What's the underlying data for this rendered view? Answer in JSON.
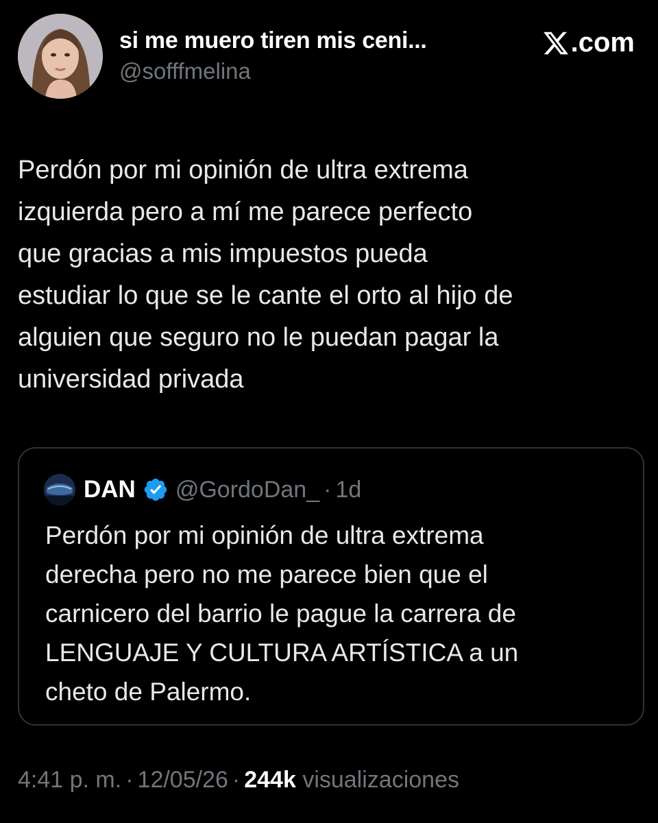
{
  "author": {
    "display_name": "si me muero tiren mis ceni...",
    "handle": "@sofffmelina"
  },
  "brand": {
    "domain_suffix": ".com",
    "icon": "x-logo-icon",
    "color": "#ffffff"
  },
  "tweet": {
    "lines": [
      "Perdón por mi opinión de ultra extrema",
      "izquierda pero a mí me parece perfecto",
      "que gracias a mis impuestos pueda",
      "estudiar lo que se le cante el orto al hijo de",
      "alguien que seguro no le puedan pagar la",
      "universidad privada"
    ]
  },
  "quoted_tweet": {
    "display_name": "DAN",
    "verified_icon": "verified-badge-icon",
    "verified_color": "#1d9bf0",
    "handle": "@GordoDan_",
    "separator": "·",
    "time": "1d",
    "lines": [
      "Perdón por mi opinión de ultra extrema",
      "derecha pero no me parece bien que el",
      "carnicero del barrio le pague la carrera de",
      "LENGUAJE Y CULTURA ARTÍSTICA a un",
      "cheto de Palermo."
    ]
  },
  "footer": {
    "time": "4:41 p. m.",
    "separator": "·",
    "date": "12/05/26",
    "views_count": "244k",
    "views_label": "visualizaciones"
  },
  "colors": {
    "background": "#000000",
    "text": "#e7e9ea",
    "secondary_text": "#71767b",
    "border": "#2f3336"
  }
}
